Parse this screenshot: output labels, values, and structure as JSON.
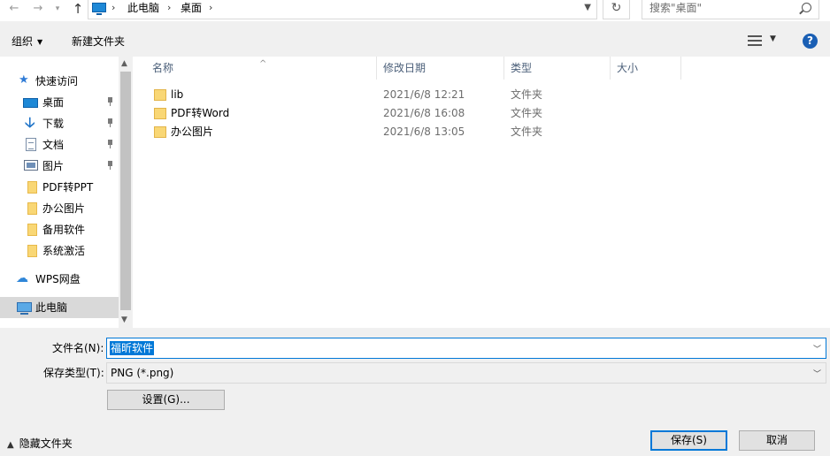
{
  "address_bar": {
    "crumbs": [
      "此电脑",
      "桌面"
    ],
    "search_placeholder": "搜索\"桌面\""
  },
  "toolbar": {
    "organize_label": "组织",
    "new_folder_label": "新建文件夹",
    "help_glyph": "?"
  },
  "nav": {
    "items": [
      {
        "label": "快速访问",
        "icon": "star-icon"
      },
      {
        "label": "桌面",
        "icon": "desktop-icon",
        "pinned": true
      },
      {
        "label": "下载",
        "icon": "download-icon",
        "pinned": true
      },
      {
        "label": "文档",
        "icon": "document-icon",
        "pinned": true
      },
      {
        "label": "图片",
        "icon": "pictures-icon",
        "pinned": true
      },
      {
        "label": "PDF转PPT",
        "icon": "folder-icon"
      },
      {
        "label": "办公图片",
        "icon": "folder-icon"
      },
      {
        "label": "备用软件",
        "icon": "folder-icon"
      },
      {
        "label": "系统激活",
        "icon": "folder-icon"
      },
      {
        "label": "WPS网盘",
        "icon": "cloud-icon"
      },
      {
        "label": "此电脑",
        "icon": "computer-icon",
        "selected": true
      }
    ]
  },
  "file_list": {
    "columns": [
      "名称",
      "修改日期",
      "类型",
      "大小"
    ],
    "rows": [
      {
        "name": "lib",
        "date": "2021/6/8 12:21",
        "type": "文件夹"
      },
      {
        "name": "PDF转Word",
        "date": "2021/6/8 16:08",
        "type": "文件夹"
      },
      {
        "name": "办公图片",
        "date": "2021/6/8 13:05",
        "type": "文件夹"
      }
    ]
  },
  "form": {
    "filename_label": "文件名(N):",
    "filename_value": "福昕软件",
    "filetype_label": "保存类型(T):",
    "filetype_value": "PNG (*.png)",
    "settings_label": "设置(G)...",
    "hide_folders_label": "隐藏文件夹",
    "save_label": "保存(S)",
    "cancel_label": "取消"
  },
  "colors": {
    "accent": "#0078d7",
    "folder": "#f9d775",
    "selection": "#d9d9d9"
  }
}
